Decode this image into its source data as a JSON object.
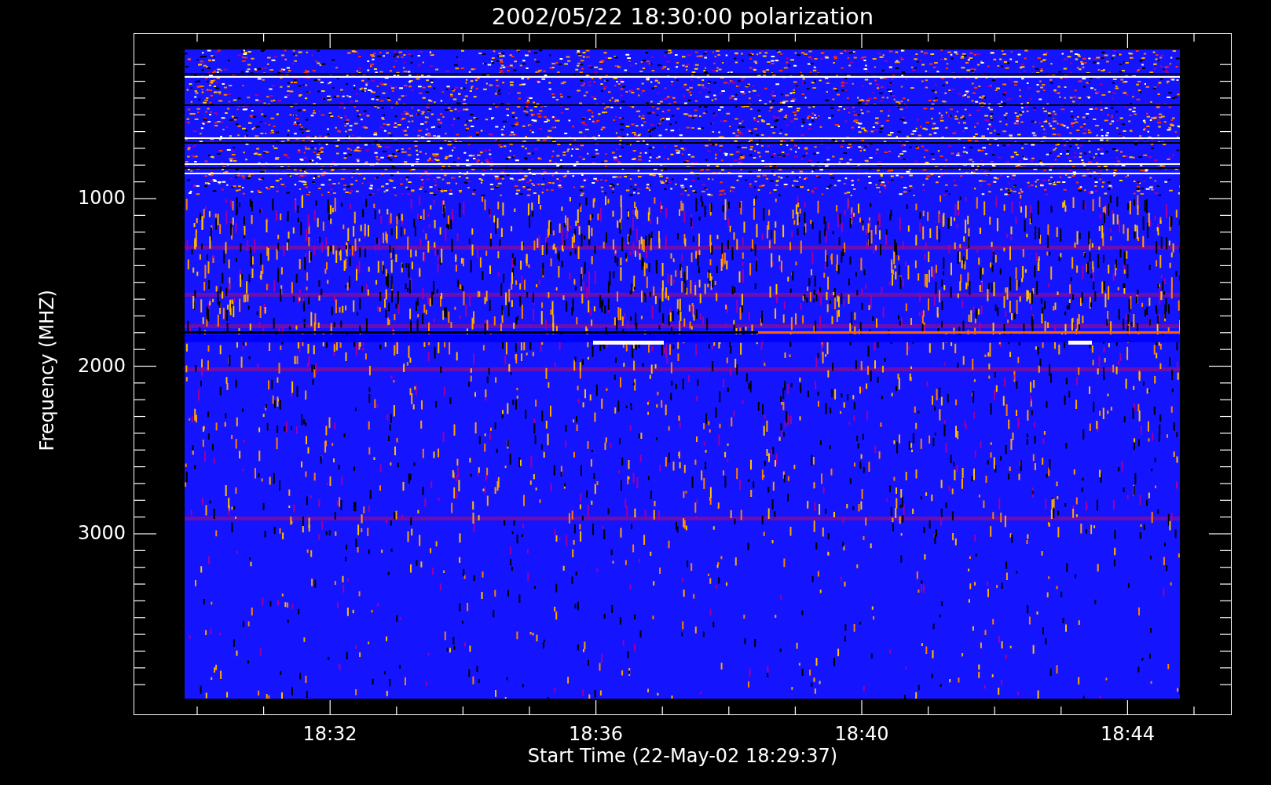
{
  "title": "2002/05/22 18:30:00 polarization",
  "y_axis": {
    "label": "Frequency (MHZ)",
    "ticks": [
      "1000",
      "2000",
      "3000"
    ]
  },
  "x_axis": {
    "label": "Start Time (22-May-02 18:29:37)",
    "ticks": [
      "18:32",
      "18:36",
      "18:40",
      "18:44"
    ]
  }
}
